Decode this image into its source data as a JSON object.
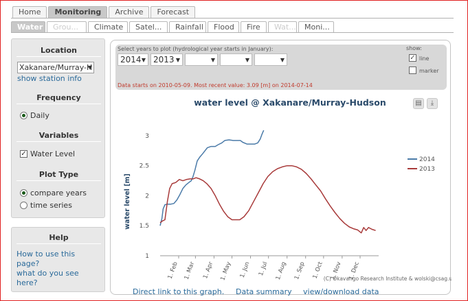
{
  "top_tabs": [
    {
      "label": "Home",
      "active": false
    },
    {
      "label": "Monitoring",
      "active": true
    },
    {
      "label": "Archive",
      "active": false
    },
    {
      "label": "Forecast",
      "active": false
    }
  ],
  "sub_tabs": [
    {
      "label": "Water",
      "state": "active"
    },
    {
      "label": "Grou...",
      "state": "disabled"
    },
    {
      "label": "Climate",
      "state": "normal"
    },
    {
      "label": "Satel...",
      "state": "normal"
    },
    {
      "label": "Rainfall",
      "state": "normal"
    },
    {
      "label": "Flood",
      "state": "normal"
    },
    {
      "label": "Fire",
      "state": "normal"
    },
    {
      "label": "Wat...",
      "state": "disabled"
    },
    {
      "label": "Moni...",
      "state": "normal"
    }
  ],
  "sidebar": {
    "location_title": "Location",
    "location_value": "Xakanare/Murray-H",
    "show_station": "show station info",
    "frequency_title": "Frequency",
    "frequency_option": "Daily",
    "variables_title": "Variables",
    "variable_option": "Water Level",
    "plottype_title": "Plot Type",
    "plottype_options": [
      "compare years",
      "time series"
    ],
    "help_title": "Help",
    "help_link1": "How to use this page?",
    "help_link2": "what do you see here?"
  },
  "controls": {
    "years_label": "Select years to plot (hydrological year starts in January):",
    "year1": "2014",
    "year2": "2013",
    "show_label": "show:",
    "show_line": "line",
    "show_marker": "marker",
    "note": "Data starts on 2010-05-09. Most recent value: 3.09 [m] on 2014-07-14"
  },
  "icons": {
    "print": "printer-icon",
    "download": "download-icon"
  },
  "colors": {
    "series_2014": "#4a7aa8",
    "series_2013": "#a83a3a",
    "title": "#2a4a6a"
  },
  "credit": "(C) Okavango Research Institute & wolski@csag.uct.ac.za",
  "links": {
    "direct": "Direct link to this graph.",
    "summary": "Data summary",
    "download": "view/download data"
  },
  "chart_data": {
    "type": "line",
    "title": "water level @ Xakanare/Murray-Hudson",
    "ylabel": "water level [m]",
    "xlabel": "",
    "ylim": [
      1,
      3.25
    ],
    "yticks": [
      1,
      1.5,
      2,
      2.5,
      3
    ],
    "xticks": [
      "1. Feb",
      "1. Mar",
      "1. Apr",
      "1. May",
      "1. Jun",
      "1. Jul",
      "1. Aug",
      "1. Sep",
      "1. Oct",
      "1. Nov",
      "1. Dec"
    ],
    "xlim_days": [
      0,
      365
    ],
    "legend": "right",
    "series": [
      {
        "name": "2014",
        "points": [
          [
            0,
            1.5
          ],
          [
            3,
            1.62
          ],
          [
            5,
            1.78
          ],
          [
            8,
            1.85
          ],
          [
            12,
            1.86
          ],
          [
            18,
            1.86
          ],
          [
            23,
            1.87
          ],
          [
            28,
            1.93
          ],
          [
            33,
            2.02
          ],
          [
            38,
            2.12
          ],
          [
            43,
            2.18
          ],
          [
            48,
            2.22
          ],
          [
            52,
            2.25
          ],
          [
            55,
            2.32
          ],
          [
            58,
            2.42
          ],
          [
            62,
            2.58
          ],
          [
            66,
            2.64
          ],
          [
            71,
            2.7
          ],
          [
            75,
            2.75
          ],
          [
            79,
            2.8
          ],
          [
            85,
            2.82
          ],
          [
            92,
            2.82
          ],
          [
            97,
            2.85
          ],
          [
            103,
            2.88
          ],
          [
            108,
            2.92
          ],
          [
            115,
            2.93
          ],
          [
            122,
            2.92
          ],
          [
            129,
            2.92
          ],
          [
            134,
            2.92
          ],
          [
            138,
            2.89
          ],
          [
            145,
            2.86
          ],
          [
            152,
            2.86
          ],
          [
            158,
            2.86
          ],
          [
            163,
            2.88
          ],
          [
            167,
            2.94
          ],
          [
            170,
            3.02
          ],
          [
            173,
            3.09
          ]
        ]
      },
      {
        "name": "2013",
        "points": [
          [
            0,
            1.55
          ],
          [
            4,
            1.58
          ],
          [
            8,
            1.6
          ],
          [
            12,
            1.9
          ],
          [
            16,
            2.12
          ],
          [
            20,
            2.2
          ],
          [
            26,
            2.22
          ],
          [
            32,
            2.27
          ],
          [
            38,
            2.25
          ],
          [
            44,
            2.27
          ],
          [
            50,
            2.28
          ],
          [
            55,
            2.28
          ],
          [
            60,
            2.3
          ],
          [
            66,
            2.28
          ],
          [
            72,
            2.25
          ],
          [
            78,
            2.2
          ],
          [
            85,
            2.12
          ],
          [
            92,
            2.0
          ],
          [
            99,
            1.86
          ],
          [
            106,
            1.74
          ],
          [
            113,
            1.65
          ],
          [
            120,
            1.6
          ],
          [
            127,
            1.6
          ],
          [
            133,
            1.6
          ],
          [
            140,
            1.65
          ],
          [
            148,
            1.75
          ],
          [
            156,
            1.9
          ],
          [
            164,
            2.05
          ],
          [
            172,
            2.2
          ],
          [
            180,
            2.32
          ],
          [
            188,
            2.4
          ],
          [
            196,
            2.45
          ],
          [
            204,
            2.48
          ],
          [
            212,
            2.5
          ],
          [
            220,
            2.5
          ],
          [
            228,
            2.48
          ],
          [
            236,
            2.44
          ],
          [
            244,
            2.37
          ],
          [
            252,
            2.28
          ],
          [
            260,
            2.18
          ],
          [
            268,
            2.08
          ],
          [
            276,
            1.95
          ],
          [
            284,
            1.83
          ],
          [
            292,
            1.72
          ],
          [
            300,
            1.62
          ],
          [
            308,
            1.54
          ],
          [
            316,
            1.48
          ],
          [
            323,
            1.45
          ],
          [
            330,
            1.43
          ],
          [
            336,
            1.38
          ],
          [
            340,
            1.47
          ],
          [
            344,
            1.42
          ],
          [
            348,
            1.47
          ],
          [
            354,
            1.44
          ],
          [
            360,
            1.42
          ]
        ]
      }
    ]
  }
}
